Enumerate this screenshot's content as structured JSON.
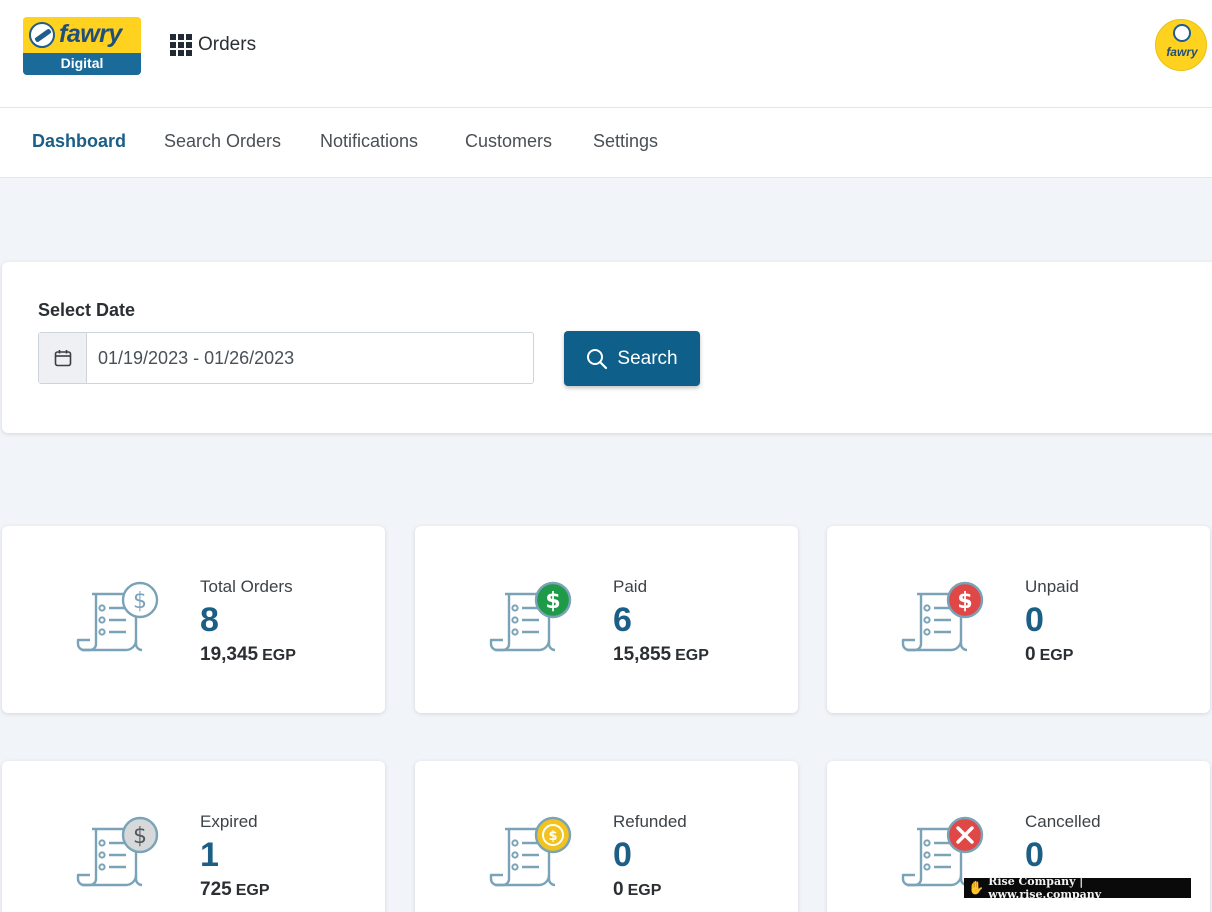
{
  "header": {
    "logo": {
      "word": "fawry",
      "sub": "Digital"
    },
    "app_name": "Orders",
    "avatar_word": "fawry"
  },
  "nav": {
    "items": [
      {
        "label": "Dashboard",
        "active": true
      },
      {
        "label": "Search Orders",
        "active": false
      },
      {
        "label": "Notifications",
        "active": false
      },
      {
        "label": "Customers",
        "active": false
      },
      {
        "label": "Settings",
        "active": false
      }
    ]
  },
  "filter": {
    "label": "Select Date",
    "date_range": "01/19/2023 - 01/26/2023",
    "search_label": "Search"
  },
  "stats": [
    {
      "title": "Total Orders",
      "count": "8",
      "amount": "19,345",
      "currency": "EGP",
      "badge": "dollar-outline",
      "badge_color": "#7aa3b8"
    },
    {
      "title": "Paid",
      "count": "6",
      "amount": "15,855",
      "currency": "EGP",
      "badge": "dollar",
      "badge_color": "#1e9a49"
    },
    {
      "title": "Unpaid",
      "count": "0",
      "amount": "0",
      "currency": "EGP",
      "badge": "dollar",
      "badge_color": "#e04848"
    },
    {
      "title": "Expired",
      "count": "1",
      "amount": "725",
      "currency": "EGP",
      "badge": "dollar-grey",
      "badge_color": "#d6d8da"
    },
    {
      "title": "Refunded",
      "count": "0",
      "amount": "0",
      "currency": "EGP",
      "badge": "coin-refund",
      "badge_color": "#f2c21d"
    },
    {
      "title": "Cancelled",
      "count": "0",
      "amount": "",
      "currency": "",
      "badge": "x",
      "badge_color": "#e04848"
    }
  ],
  "watermark": {
    "text": "Rise Company | www.rise.company"
  }
}
